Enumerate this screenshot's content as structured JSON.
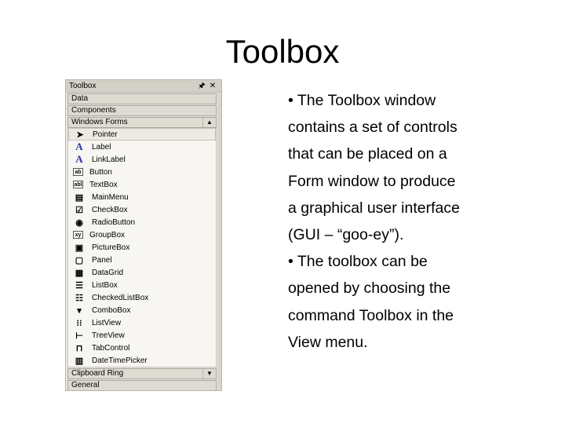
{
  "slide": {
    "title": "Toolbox",
    "bullets": [
      [
        "• The Toolbox window",
        "contains a set of controls",
        "that can be placed on a",
        "Form window to produce",
        "a graphical user interface",
        "(GUI – “goo-ey”)."
      ],
      [
        "• The toolbox can be",
        "opened by choosing the",
        "command Toolbox in the",
        "View menu."
      ]
    ]
  },
  "toolbox": {
    "title": "Toolbox",
    "pin_glyph": "🖈",
    "close_glyph": "✕",
    "categories_top": [
      "Data",
      "Components"
    ],
    "windows_forms_label": "Windows Forms",
    "items": [
      {
        "label": "Pointer",
        "icon": "pointer-icon",
        "glyph": "➤"
      },
      {
        "label": "Label",
        "icon": "label-icon",
        "glyph": "A"
      },
      {
        "label": "LinkLabel",
        "icon": "linklabel-icon",
        "glyph": "A"
      },
      {
        "label": "Button",
        "icon": "button-icon",
        "glyph": "ab"
      },
      {
        "label": "TextBox",
        "icon": "textbox-icon",
        "glyph": "abl"
      },
      {
        "label": "MainMenu",
        "icon": "mainmenu-icon",
        "glyph": "▤"
      },
      {
        "label": "CheckBox",
        "icon": "checkbox-icon",
        "glyph": "☑"
      },
      {
        "label": "RadioButton",
        "icon": "radiobutton-icon",
        "glyph": "◉"
      },
      {
        "label": "GroupBox",
        "icon": "groupbox-icon",
        "glyph": "xy"
      },
      {
        "label": "PictureBox",
        "icon": "picturebox-icon",
        "glyph": "▣"
      },
      {
        "label": "Panel",
        "icon": "panel-icon",
        "glyph": "▢"
      },
      {
        "label": "DataGrid",
        "icon": "datagrid-icon",
        "glyph": "▦"
      },
      {
        "label": "ListBox",
        "icon": "listbox-icon",
        "glyph": "☰"
      },
      {
        "label": "CheckedListBox",
        "icon": "checkedlistbox-icon",
        "glyph": "☷"
      },
      {
        "label": "ComboBox",
        "icon": "combobox-icon",
        "glyph": "▾"
      },
      {
        "label": "ListView",
        "icon": "listview-icon",
        "glyph": "⁝⁝"
      },
      {
        "label": "TreeView",
        "icon": "treeview-icon",
        "glyph": "⊢"
      },
      {
        "label": "TabControl",
        "icon": "tabcontrol-icon",
        "glyph": "⊓"
      },
      {
        "label": "DateTimePicker",
        "icon": "datetimepicker-icon",
        "glyph": "▥"
      }
    ],
    "clipboard_ring_label": "Clipboard Ring",
    "general_label": "General"
  }
}
